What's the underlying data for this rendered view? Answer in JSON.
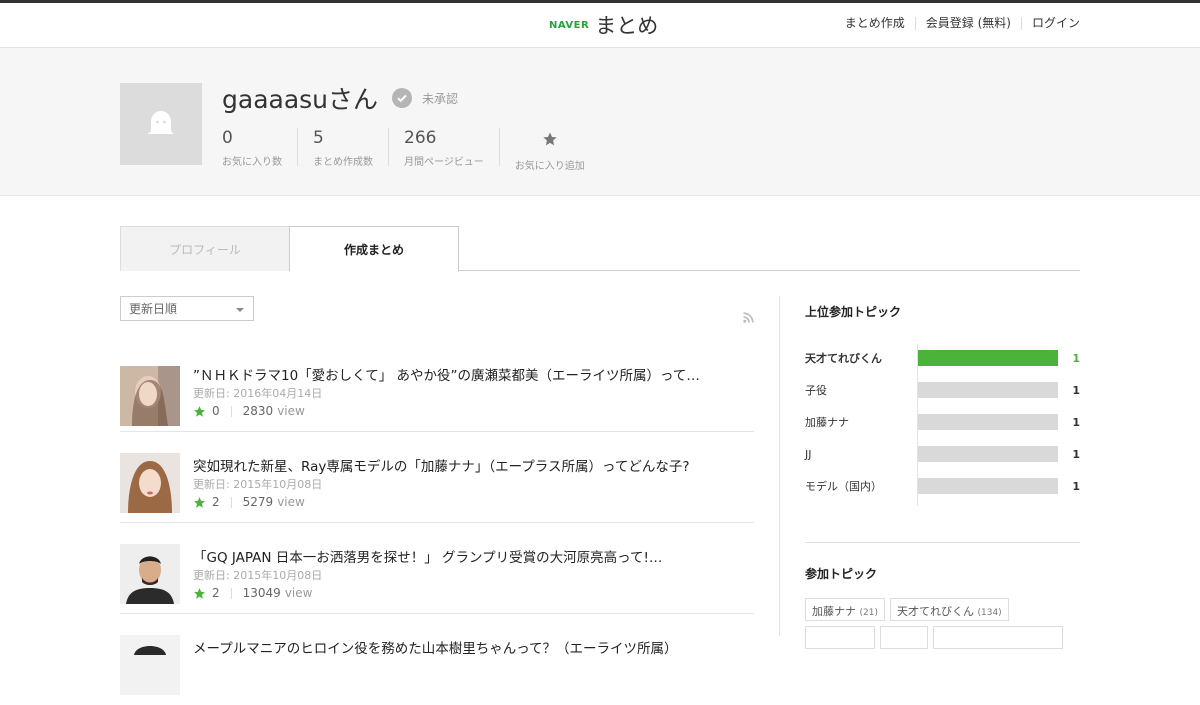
{
  "header": {
    "logo_brand": "NAVER",
    "logo_text": "まとめ",
    "nav": [
      "まとめ作成",
      "会員登録 (無料)",
      "ログイン"
    ]
  },
  "profile": {
    "username": "gaaaasuさん",
    "verify_status": "未承認",
    "stats": [
      {
        "value": "0",
        "label": "お気に入り数"
      },
      {
        "value": "5",
        "label": "まとめ作成数"
      },
      {
        "value": "266",
        "label": "月間ページビュー"
      }
    ],
    "fav_add_label": "お気に入り追加"
  },
  "tabs": [
    "プロフィール",
    "作成まとめ"
  ],
  "sort": {
    "selected": "更新日順"
  },
  "items": [
    {
      "title": "”ＮＨＫドラマ10「愛おしくて」 あやか役”の廣瀬菜都美（エーライツ所属）って…",
      "date": "更新日: 2016年04月14日",
      "favs": "0",
      "views": "2830",
      "view_label": "view"
    },
    {
      "title": "突如現れた新星、Ray専属モデルの「加藤ナナ」（エープラス所属）ってどんな子?",
      "date": "更新日: 2015年10月08日",
      "favs": "2",
      "views": "5279",
      "view_label": "view"
    },
    {
      "title": "「GQ JAPAN 日本一お洒落男を探せ！」 グランプリ受賞の大河原亮高って!…",
      "date": "更新日: 2015年10月08日",
      "favs": "2",
      "views": "13049",
      "view_label": "view"
    },
    {
      "title": "メープルマニアのヒロイン役を務めた山本樹里ちゃんって？（エーライツ所属）",
      "date": "",
      "favs": "",
      "views": "",
      "view_label": ""
    }
  ],
  "sidebar": {
    "top_topics_title": "上位参加トピック",
    "top_topics": [
      {
        "name": "天才てれびくん",
        "count": "1",
        "fill": 1.0
      },
      {
        "name": "子役",
        "count": "1",
        "fill": 0.0
      },
      {
        "name": "加藤ナナ",
        "count": "1",
        "fill": 0.0
      },
      {
        "name": "JJ",
        "count": "1",
        "fill": 0.0
      },
      {
        "name": "モデル（国内）",
        "count": "1",
        "fill": 0.0
      }
    ],
    "topics_title": "参加トピック",
    "topics": [
      {
        "name": "加藤ナナ",
        "count": "(21)"
      },
      {
        "name": "天才てれびくん",
        "count": "(134)"
      }
    ]
  },
  "colors": {
    "accent": "#4bb33a",
    "bar_empty": "#d9d9d9"
  }
}
